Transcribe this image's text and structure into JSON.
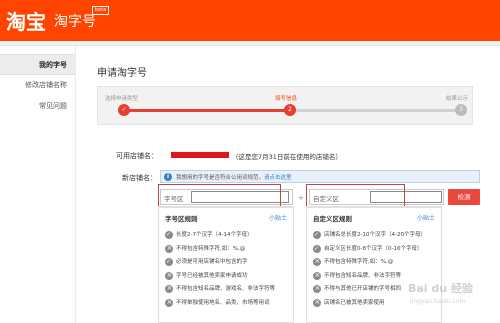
{
  "header": {
    "logo": "淘宝",
    "product": "淘字号",
    "badge": "beta"
  },
  "sidebar": {
    "items": [
      {
        "label": "我的字号"
      },
      {
        "label": "修改店铺名称"
      },
      {
        "label": "常见问题"
      }
    ]
  },
  "page": {
    "title": "申请淘字号"
  },
  "progress": {
    "steps": [
      {
        "label": "选择申请类型",
        "number": ""
      },
      {
        "label": "填写信息",
        "number": "2"
      },
      {
        "label": "结果公示",
        "number": "3"
      }
    ],
    "current_step": 2
  },
  "form": {
    "available_shop_label": "可用店铺名：",
    "available_shop_note": "（这是您7月31日前在使用的店铺名）",
    "new_shop_label": "新店铺名：",
    "tip_text": "我想用的字号是否符合公用词规范，",
    "tip_link": "请点击这里",
    "brand_field_placeholder": "字号区",
    "plus": "+",
    "custom_field_placeholder": "自定义区",
    "check_button": "检测"
  },
  "rules_left": {
    "title": "字号区规则",
    "link": "小贴士",
    "items": [
      {
        "text": "长度2-7个汉字（4-14个字母）",
        "type": "ok"
      },
      {
        "text": "不得包含特殊字符,如：%,@",
        "type": "no"
      },
      {
        "text": "必须是可用店铺名中包含的字",
        "type": "ok"
      },
      {
        "text": "字号已经被其他卖家申请成功",
        "type": "no"
      },
      {
        "text": "不得包含知名品牌、游戏名、非法字符等",
        "type": "no"
      },
      {
        "text": "不得单独使用地名、品类、市场等用词",
        "type": "no"
      }
    ]
  },
  "rules_right": {
    "title": "自定义区规则",
    "link": "小贴士",
    "items": [
      {
        "text": "店铺名总长度2-10个汉字（4-20个字母）",
        "type": "ok"
      },
      {
        "text": "自定义区长度0-8个汉字（0-16个字母）",
        "type": "ok"
      },
      {
        "text": "不得包含特殊字符,如：%,@",
        "type": "no"
      },
      {
        "text": "不得包含知名品牌、非法字符等",
        "type": "no"
      },
      {
        "text": "不得与其他已开店铺的字号相同",
        "type": "no"
      },
      {
        "text": "店铺名已被其他卖家使用",
        "type": "no"
      }
    ]
  },
  "watermark": {
    "text": "Bai du 经验",
    "sub": "jingyan.baidu.com"
  },
  "colors": {
    "brand": "#ff4400",
    "accent_red": "#e8493c",
    "link_blue": "#3a7fc4",
    "done_step": "#e5402f",
    "pending_step": "#bbbbbb"
  }
}
